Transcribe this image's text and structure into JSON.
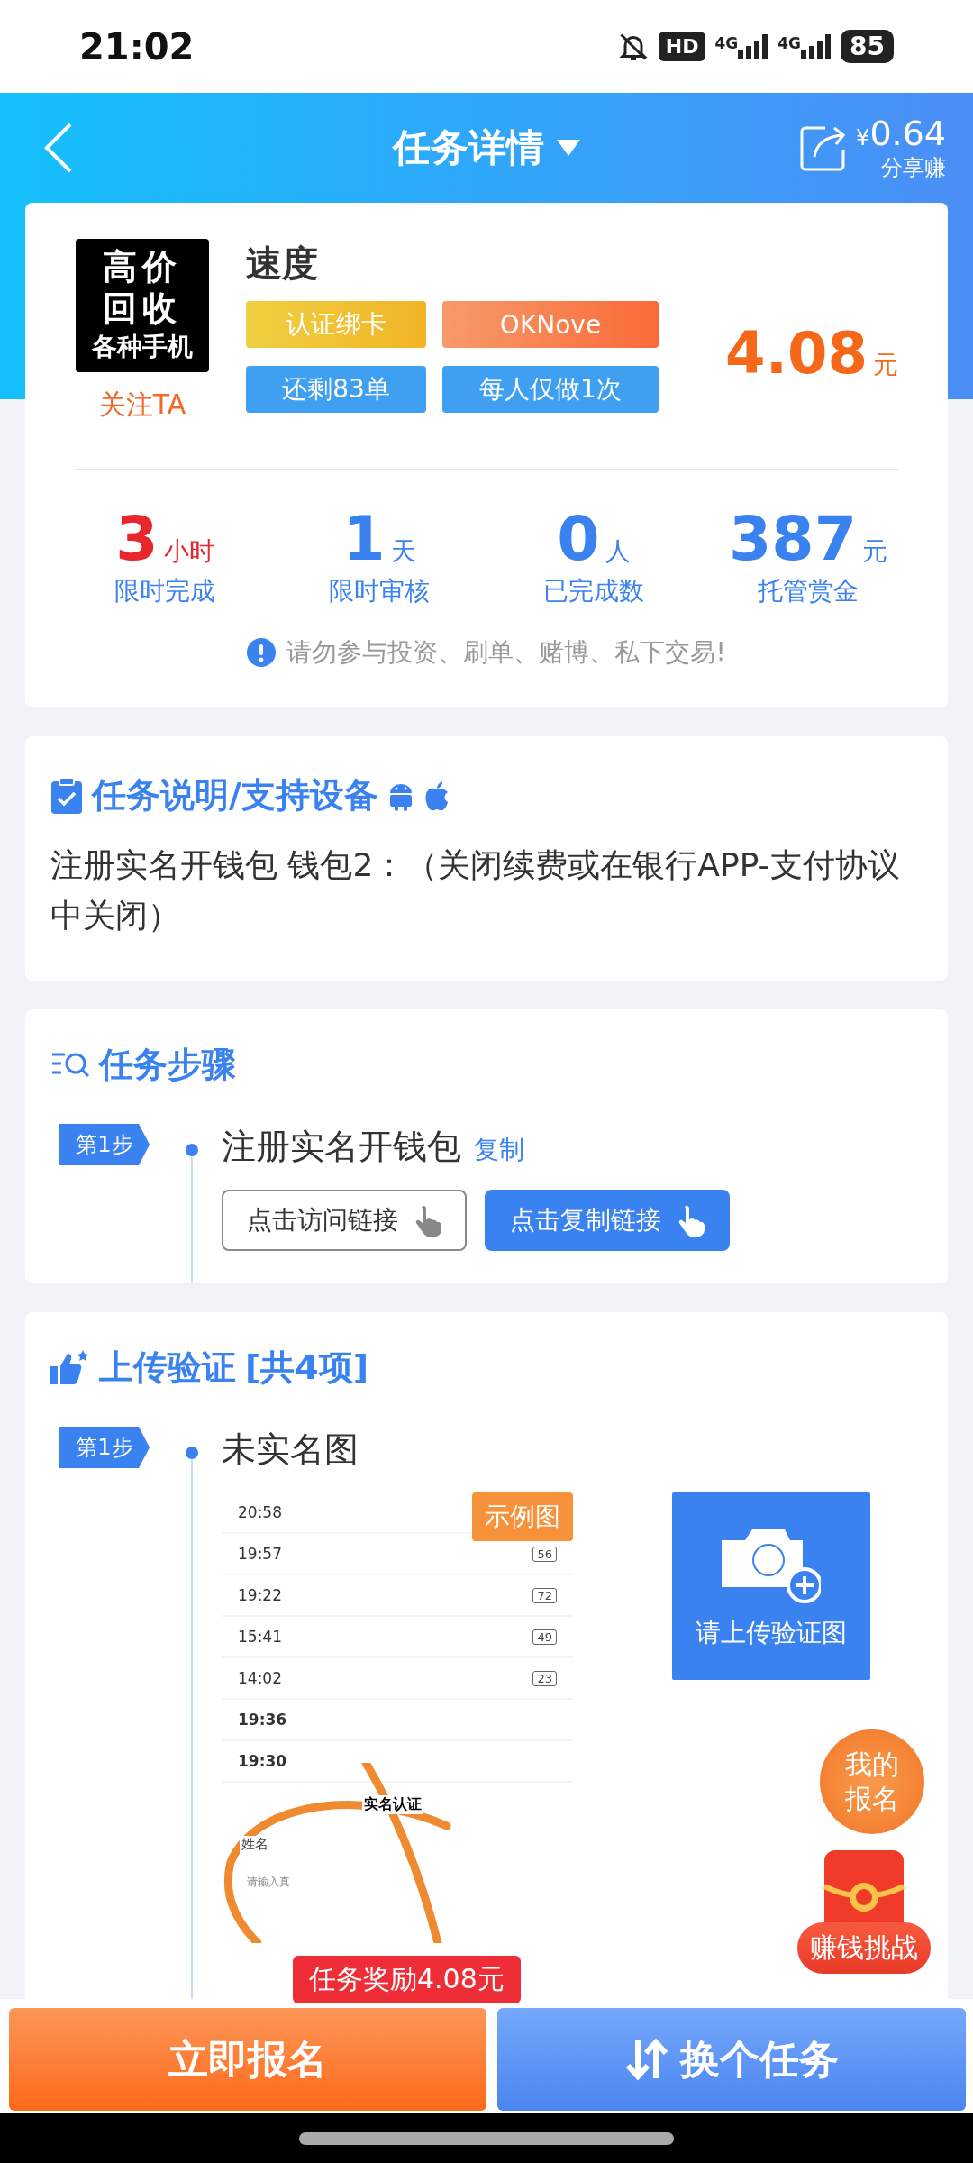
{
  "status_bar": {
    "time": "21:02",
    "hd_badge": "HD",
    "networks": [
      {
        "label": "4G"
      },
      {
        "label": "4G"
      }
    ],
    "battery": "85"
  },
  "header": {
    "title": "任务详情",
    "share_currency": "¥",
    "share_amount": "0.64",
    "share_label": "分享赚"
  },
  "task": {
    "logo_lines": [
      "高价",
      "回收",
      "各种手机"
    ],
    "follow": "关注TA",
    "name": "速度",
    "tags": [
      {
        "text": "认证绑卡",
        "kind": "yellow"
      },
      {
        "text": "OKNove",
        "kind": "orange"
      },
      {
        "text": "还剩83单",
        "kind": "blue"
      },
      {
        "text": "每人仅做1次",
        "kind": "blue"
      }
    ],
    "price": "4.08",
    "price_unit": "元",
    "stats": [
      {
        "value": "3",
        "unit": "小时",
        "label": "限时完成",
        "kind": "urgent"
      },
      {
        "value": "1",
        "unit": "天",
        "label": "限时审核",
        "kind": "normal"
      },
      {
        "value": "0",
        "unit": "人",
        "label": "已完成数",
        "kind": "normal"
      },
      {
        "value": "387",
        "unit": "元",
        "label": "托管赏金",
        "kind": "normal"
      }
    ],
    "warning": "请勿参与投资、刷单、赌博、私下交易!"
  },
  "description": {
    "title": "任务说明/支持设备",
    "text": "注册实名开钱包 钱包2：（关闭续费或在银行APP-支付协议中关闭）"
  },
  "steps": {
    "title": "任务步骤",
    "items": [
      {
        "badge": "第1步",
        "text": "注册实名开钱包",
        "copy": "复制",
        "buttons": [
          {
            "label": "点击访问链接",
            "kind": "outline"
          },
          {
            "label": "点击复制链接",
            "kind": "primary"
          }
        ]
      }
    ]
  },
  "upload": {
    "title": "上传验证",
    "count": "[共4项]",
    "items": [
      {
        "badge": "第1步",
        "text": "未实名图",
        "example_label": "示例图",
        "upload_label": "请上传验证图",
        "example": {
          "rows": [
            {
              "time": "20:58"
            },
            {
              "time": "19:57",
              "battery": "56"
            },
            {
              "time": "19:22",
              "battery": "72"
            },
            {
              "time": "15:41",
              "battery": "49"
            },
            {
              "time": "14:02",
              "battery": "23"
            }
          ],
          "bold_rows": [
            {
              "time": "19:36"
            },
            {
              "time": "19:30"
            }
          ],
          "page_title": "实名认证",
          "field_label": "姓名",
          "field_hint": "请输入真"
        }
      }
    ]
  },
  "floating": {
    "my_signup": "我的报名",
    "challenge": "赚钱挑战"
  },
  "bottom": {
    "tooltip": "任务奖励4.08元",
    "signup": "立即报名",
    "switch": "换个任务"
  }
}
